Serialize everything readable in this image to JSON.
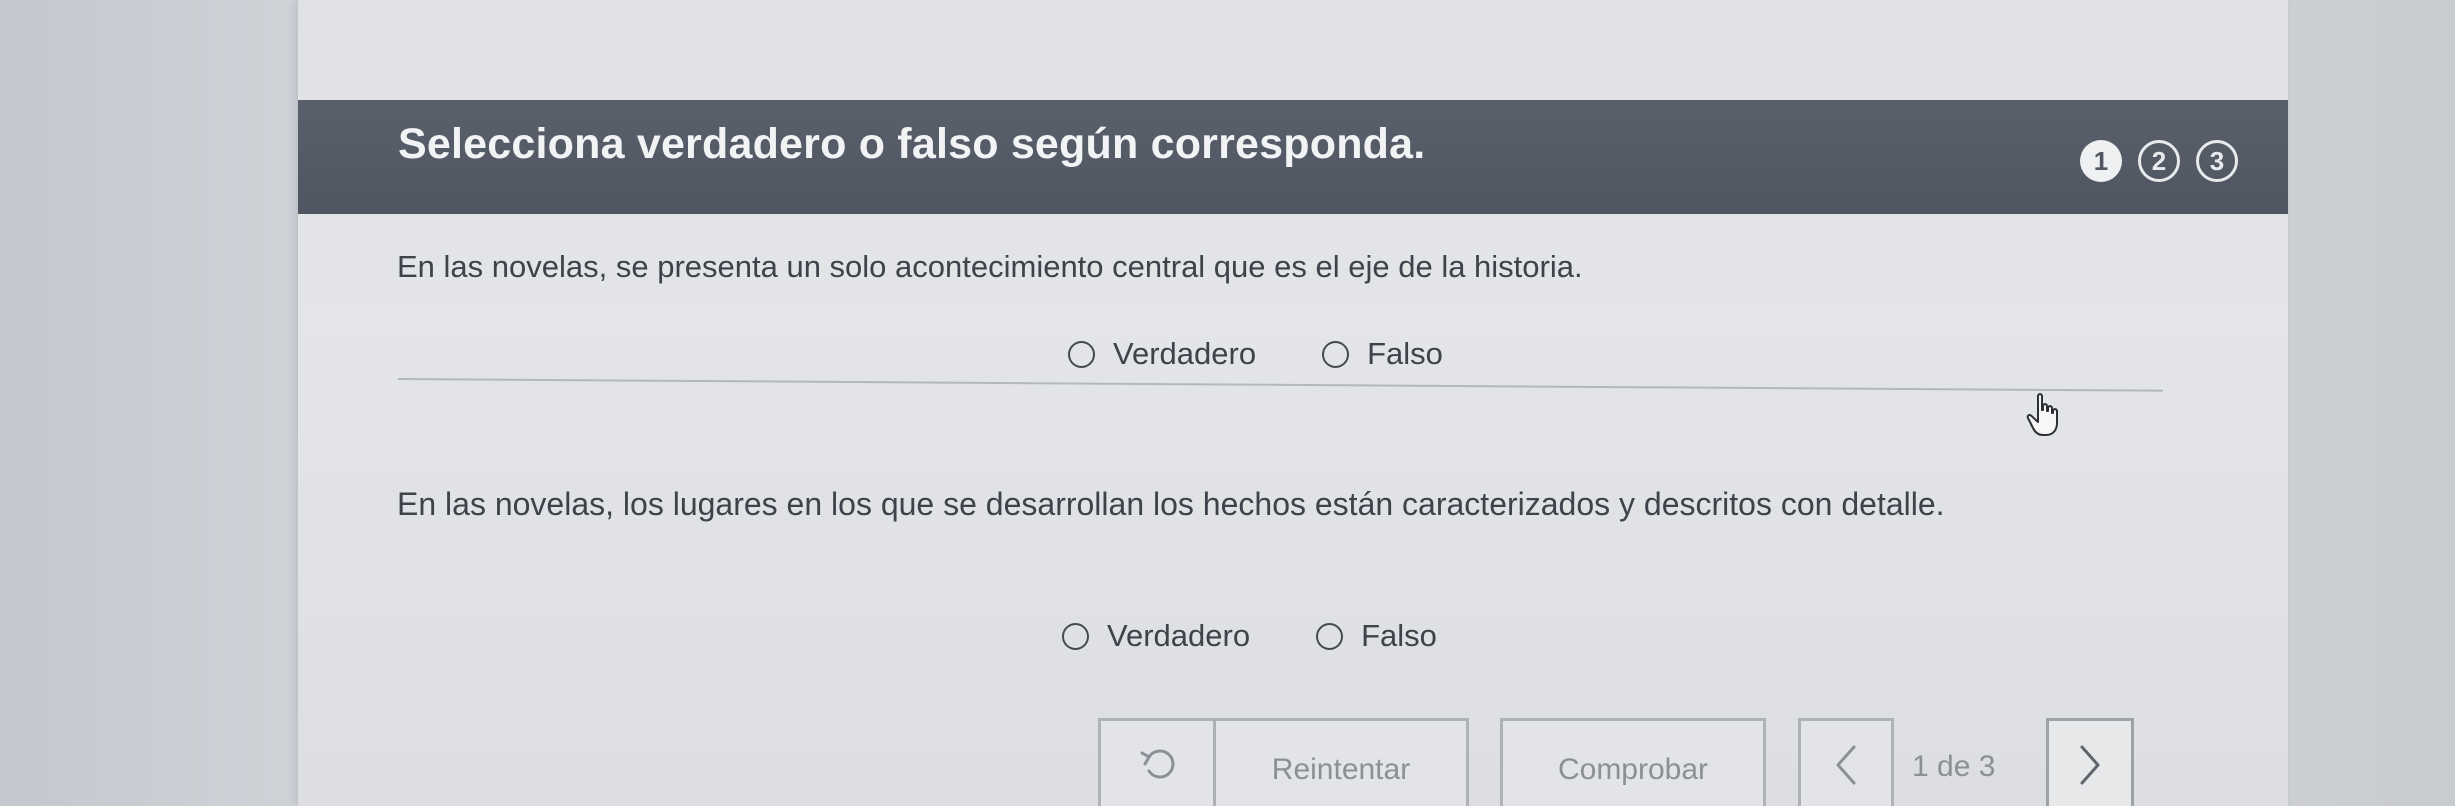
{
  "header": {
    "title": "Selecciona verdadero o falso según corresponda.",
    "steps": [
      "1",
      "2",
      "3"
    ],
    "active_step": 1
  },
  "questions": [
    {
      "text": "En las novelas, se presenta un solo acontecimiento central que es el eje de la historia.",
      "options": [
        "Verdadero",
        "Falso"
      ],
      "selected": null
    },
    {
      "text": "En las novelas, los lugares en los que se desarrollan los hechos están caracterizados y descritos con detalle.",
      "options": [
        "Verdadero",
        "Falso"
      ],
      "selected": null
    }
  ],
  "footer": {
    "undo_icon": "undo-icon",
    "retry_label": "Reintentar",
    "check_label": "Comprobar",
    "prev_icon": "chevron-left-icon",
    "page_indicator": "1 de 3",
    "next_icon": "chevron-right-icon"
  },
  "colors": {
    "header_bg": "#545b66",
    "panel_bg": "#e1e3e6",
    "text": "#3e434b",
    "disabled_text": "#8b9097"
  }
}
